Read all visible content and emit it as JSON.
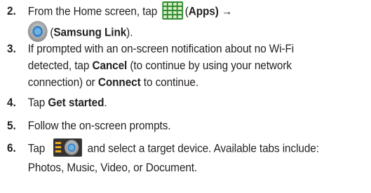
{
  "steps": [
    {
      "number": "2.",
      "line1_pre": "From the Home screen, tap ",
      "apps_icon": "apps-grid-icon",
      "line1_paren_open": "(",
      "apps_label": "Apps",
      "line1_post": ") →",
      "link_icon": "samsung-link-icon",
      "line2_paren_open": "(",
      "link_label": "Samsung Link",
      "line2_paren_close": ")."
    },
    {
      "number": "3.",
      "line1": "If prompted with an on-screen notification about no Wi-Fi",
      "line2_pre": "detected, tap ",
      "cancel_label": "Cancel",
      "line2_post": " (to continue by using your network",
      "line3_pre": "connection) or ",
      "connect_label": "Connect",
      "line3_post": " to continue."
    },
    {
      "number": "4.",
      "pre": "Tap ",
      "get_started_label": "Get started",
      "post": "."
    },
    {
      "number": "5.",
      "text": "Follow the on-screen prompts."
    },
    {
      "number": "6.",
      "pre": "Tap ",
      "menu_icon": "menu-samsung-link-icon",
      "line1_post": " and select a target device. Available tabs include:",
      "line2": "Photos, Music, Video, or Document."
    }
  ],
  "colors": {
    "text": "#231f20",
    "apps_icon_bg": "#2f8a2f",
    "menu_icon_bg": "#333333",
    "menu_bars": "#f2a81f",
    "link_blue": "#3b83c4"
  }
}
